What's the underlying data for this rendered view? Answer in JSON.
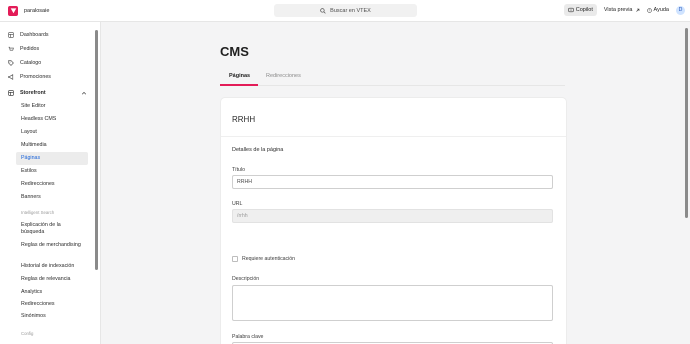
{
  "topbar": {
    "account": "paralosaie",
    "search_placeholder": "Buscar en VTEX",
    "copilot": "Copilot",
    "preview": "Vista previa",
    "help": "Ayuda",
    "avatar": "D"
  },
  "sidebar": {
    "main_items": [
      "Dashboards",
      "Pedidos",
      "Catalogo",
      "Promociones"
    ],
    "storefront": "Storefront",
    "storefront_items": [
      "Site Editor",
      "Headless CMS",
      "Layout",
      "Multimedia",
      "Páginas",
      "Estilos",
      "Redirecciones",
      "Banners"
    ],
    "section_intelligent": "Intelligent Search",
    "search_items": [
      "Explicación de la búsqueda",
      "Reglas de merchandising",
      "Historial de indexación",
      "Reglas de relevancia",
      "Analytics",
      "Redirecciones",
      "Sinónimos"
    ],
    "last_section": "Config"
  },
  "main": {
    "title": "CMS",
    "tabs": [
      "Páginas",
      "Redirecciones"
    ],
    "card": {
      "title": "RRHH",
      "section": "Detalles de la página",
      "title_label": "Título",
      "title_value": "RRHH",
      "url_label": "URL",
      "url_value": "/rrhh",
      "auth_label": "Requiere autenticación",
      "description_label": "Descripción",
      "keywords_label": "Palabra clave"
    }
  },
  "colors": {
    "brand": "#e31c58",
    "active_link": "#1a63d9"
  }
}
